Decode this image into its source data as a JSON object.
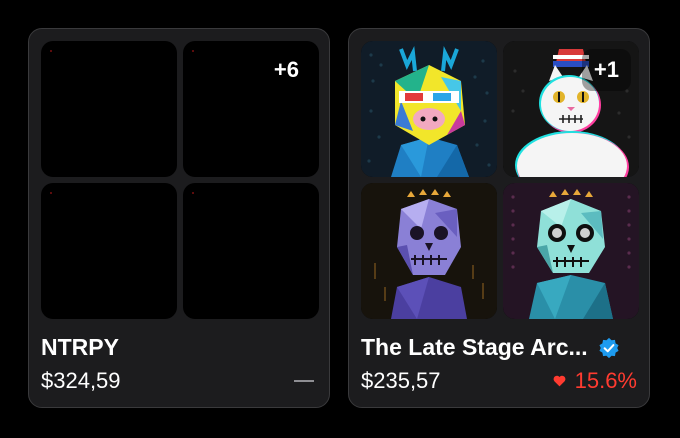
{
  "collections": [
    {
      "name": "NTRPY",
      "price": "$324,59",
      "more_count": "+6",
      "change_icon": "dash-icon",
      "thumbnails": [
        "empty",
        "empty",
        "empty",
        "empty"
      ]
    },
    {
      "name": "The Late Stage Arc...",
      "price": "$235,57",
      "more_count": "+1",
      "verified_icon": "verified-badge-icon",
      "change_icon": "heart-icon",
      "change": "15.6%",
      "thumbnails": [
        "cyber-deer-with-3d-glasses",
        "glitch-cat-with-hat",
        "purple-skull-with-crown",
        "cyan-skull-with-crown"
      ]
    }
  ],
  "colors": {
    "background": "#000000",
    "card": "#1c1c1e",
    "card_border": "#3a3a3c",
    "change_negative": "#ff3b30",
    "verified": "#1d9bf0",
    "dash": "#8e8e93"
  }
}
